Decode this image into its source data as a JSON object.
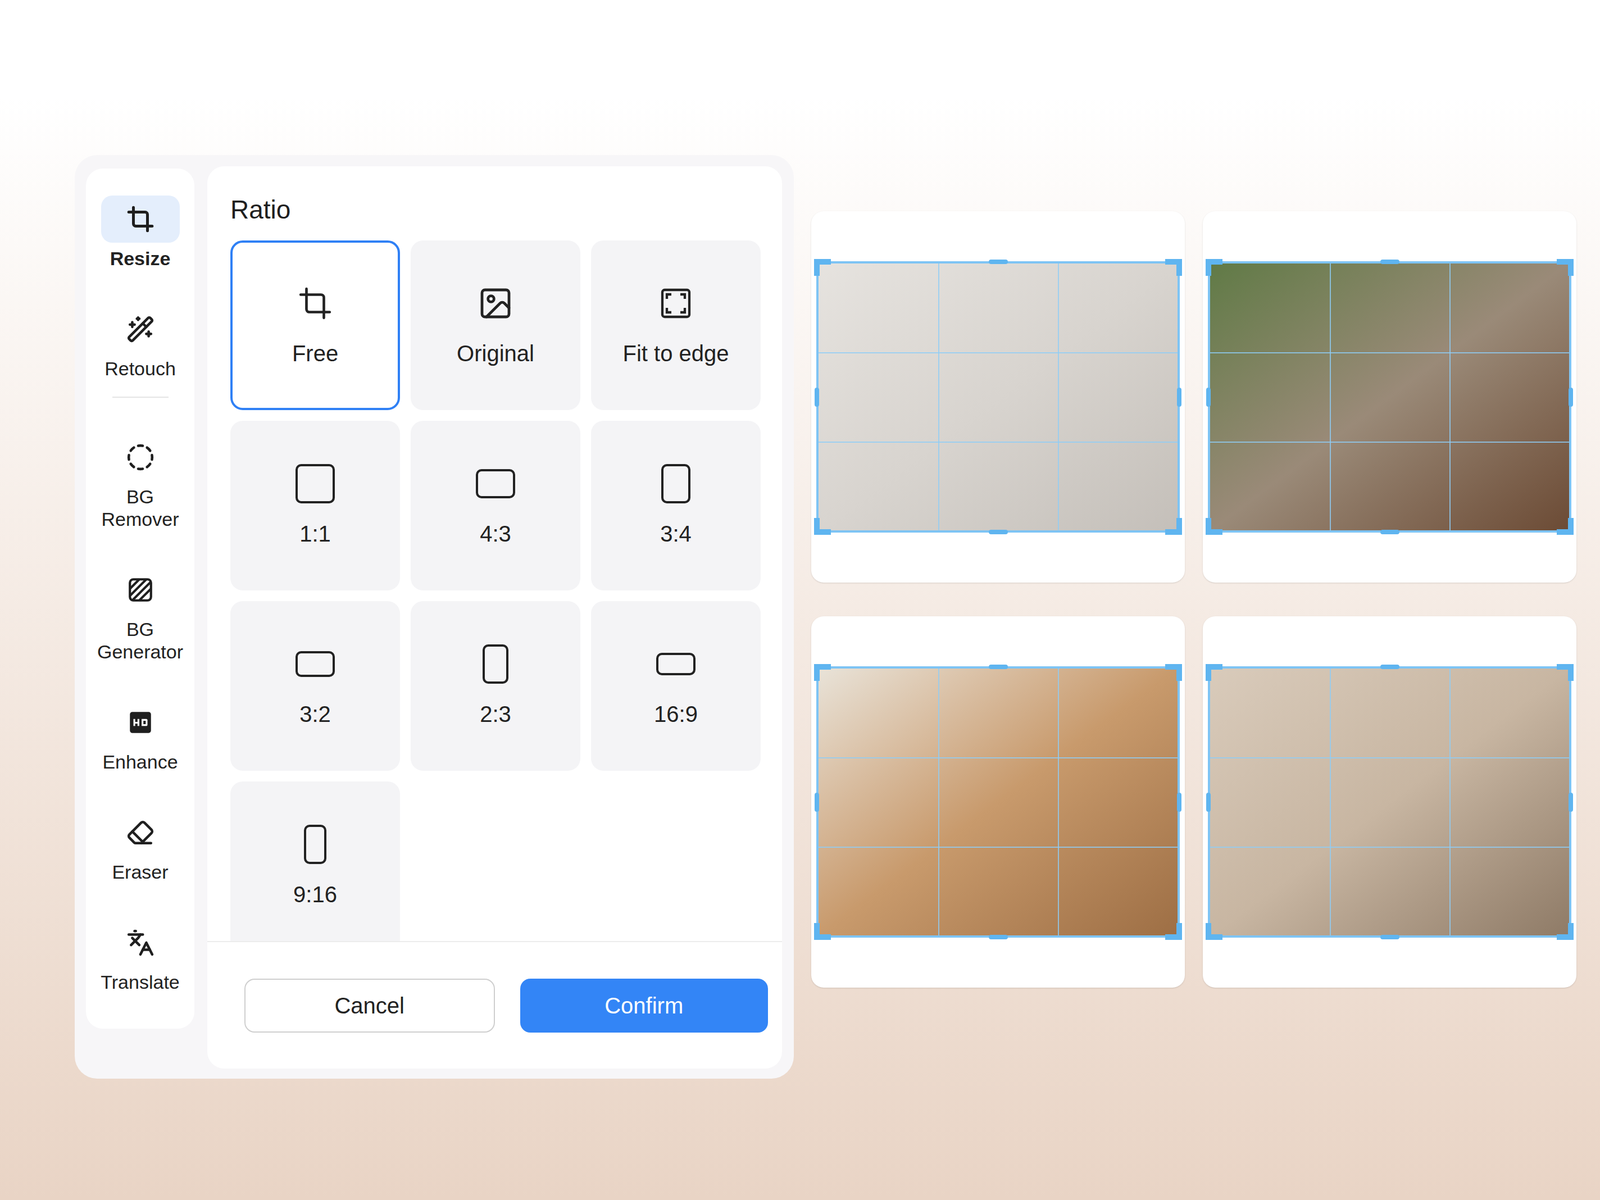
{
  "sidebar": {
    "items": [
      {
        "label": "Resize",
        "selected": true
      },
      {
        "label": "Retouch",
        "selected": false
      },
      {
        "label": "BG Remover",
        "selected": false
      },
      {
        "label": "BG Generator",
        "selected": false
      },
      {
        "label": "Enhance",
        "selected": false
      },
      {
        "label": "Eraser",
        "selected": false
      },
      {
        "label": "Translate",
        "selected": false
      }
    ]
  },
  "ratio_panel": {
    "title": "Ratio",
    "options": [
      {
        "label": "Free",
        "kind": "free",
        "selected": true
      },
      {
        "label": "Original",
        "kind": "original",
        "selected": false
      },
      {
        "label": "Fit to edge",
        "kind": "fit",
        "selected": false
      },
      {
        "label": "1:1",
        "kind": "ratio",
        "selected": false
      },
      {
        "label": "4:3",
        "kind": "ratio",
        "selected": false
      },
      {
        "label": "3:4",
        "kind": "ratio",
        "selected": false
      },
      {
        "label": "3:2",
        "kind": "ratio",
        "selected": false
      },
      {
        "label": "2:3",
        "kind": "ratio",
        "selected": false
      },
      {
        "label": "16:9",
        "kind": "ratio",
        "selected": false
      },
      {
        "label": "9:16",
        "kind": "ratio",
        "selected": false
      }
    ]
  },
  "buttons": [
    {
      "label": "Cancel",
      "kind": "secondary"
    },
    {
      "label": "Confirm",
      "kind": "primary"
    }
  ],
  "images": [
    {
      "cropping": true
    },
    {
      "cropping": true
    },
    {
      "cropping": true
    },
    {
      "cropping": true
    }
  ]
}
